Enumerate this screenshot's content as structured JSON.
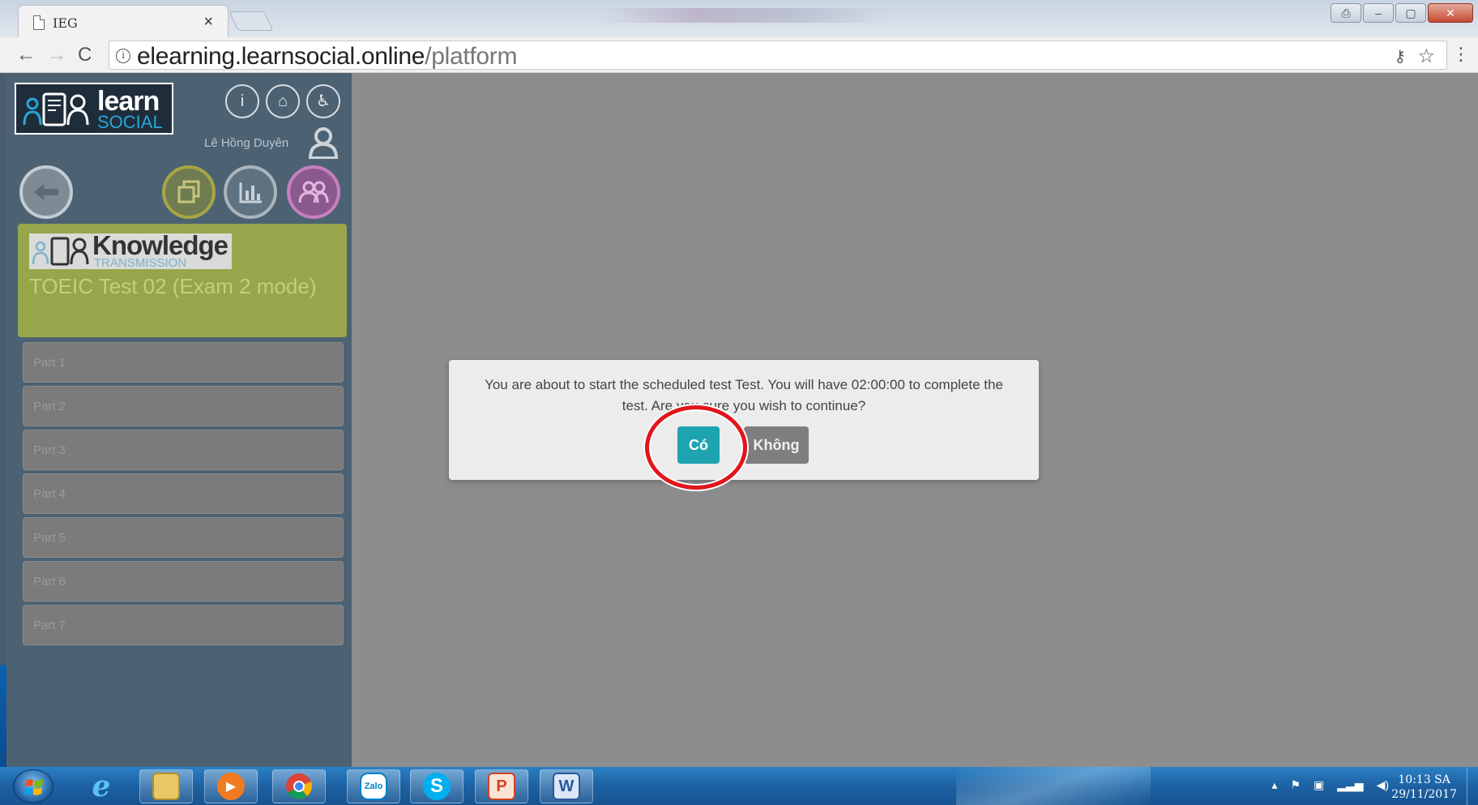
{
  "browser": {
    "tab_title": "IEG",
    "tab_close": "×",
    "url_host": "elearning.learnsocial.online",
    "url_path": "/platform",
    "window_buttons": [
      "⎙",
      "–",
      "▢",
      "✕"
    ]
  },
  "sidebar": {
    "logo_learn": "learn",
    "logo_social": "SOCIAL",
    "user_name": "Lê Hồng Duyên",
    "top_icons": [
      "info-icon",
      "home-icon",
      "accessibility-icon"
    ],
    "action_icons": [
      "back-icon",
      "copy-icon",
      "stats-icon",
      "group-icon"
    ],
    "card": {
      "brand_main": "Knowledge",
      "brand_sub": "TRANSMISSION",
      "title": "TOEIC Test 02 (Exam 2 mode)"
    },
    "parts": [
      "Part 1",
      "Part 2",
      "Part 3",
      "Part 4",
      "Part 5",
      "Part 6",
      "Part 7"
    ]
  },
  "dialog": {
    "message": "You are about to start the scheduled test Test. You will have 02:00:00 to complete the test. Are you sure you wish to continue?",
    "yes_label": "Có",
    "no_label": "Không"
  },
  "taskbar": {
    "apps": [
      "ie-icon",
      "folder-icon",
      "media-player-icon",
      "chrome-icon",
      "zalo-icon",
      "skype-icon",
      "powerpoint-icon",
      "word-icon"
    ],
    "zalo_label": "Zalo",
    "skype_label": "S",
    "ppt_label": "P",
    "word_label": "W",
    "time": "10:13 SA",
    "date": "29/11/2017",
    "tray_expand": "▴"
  },
  "colors": {
    "sidebar_bg": "#4c6273",
    "overlay": "#8d8d8d",
    "card_olive": "#97a64a",
    "yes_teal": "#1ea4b0",
    "highlight_red": "#e2151b"
  }
}
